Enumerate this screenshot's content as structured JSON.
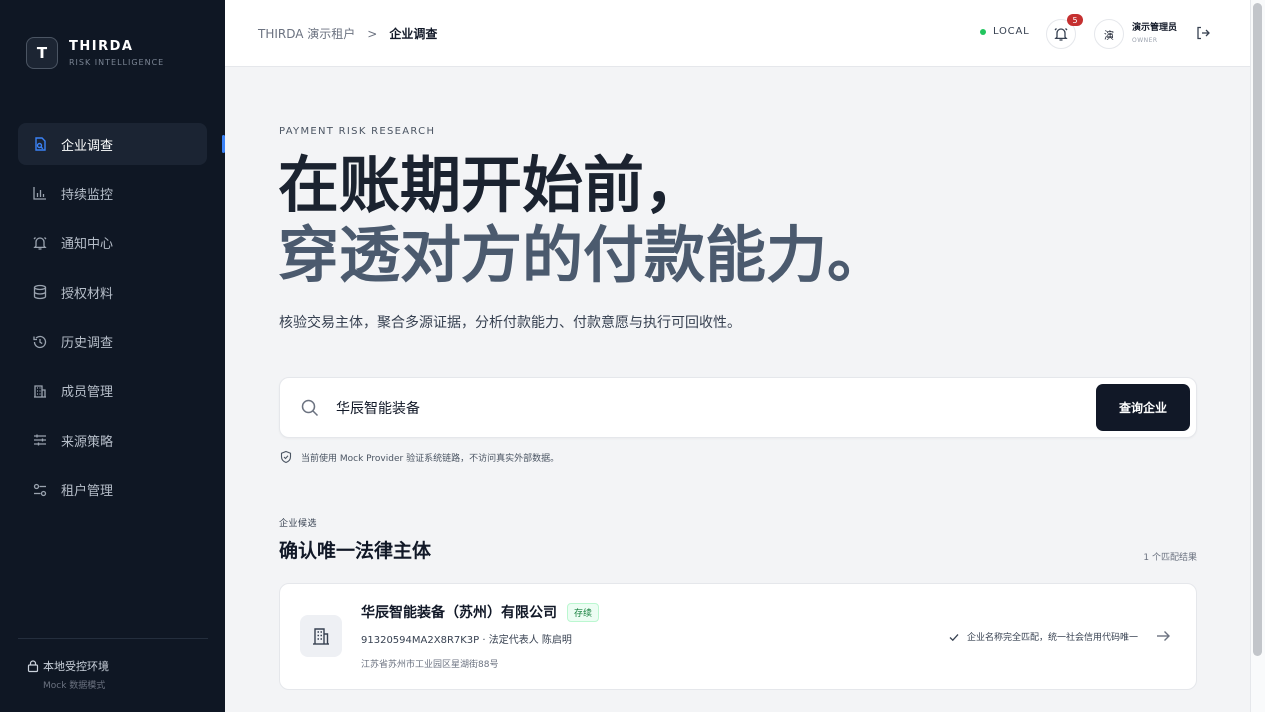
{
  "brand": {
    "logo_letter": "T",
    "name": "THIRDA",
    "subtitle": "RISK INTELLIGENCE"
  },
  "sidebar": {
    "items": [
      {
        "label": "企业调查",
        "icon": "search-document-icon",
        "active": true
      },
      {
        "label": "持续监控",
        "icon": "bar-chart-icon",
        "active": false
      },
      {
        "label": "通知中心",
        "icon": "bell-icon",
        "active": false
      },
      {
        "label": "授权材料",
        "icon": "database-icon",
        "active": false
      },
      {
        "label": "历史调查",
        "icon": "history-icon",
        "active": false
      },
      {
        "label": "成员管理",
        "icon": "building-icon",
        "active": false
      },
      {
        "label": "来源策略",
        "icon": "sliders-icon",
        "active": false
      },
      {
        "label": "租户管理",
        "icon": "settings-toggle-icon",
        "active": false
      }
    ],
    "environment": {
      "title": "本地受控环境",
      "subtitle": "Mock 数据模式"
    }
  },
  "header": {
    "breadcrumb": {
      "tenant": "THIRDA 演示租户",
      "separator": ">",
      "current": "企业调查"
    },
    "env_label": "LOCAL",
    "notifications_count": "5",
    "avatar_text": "演",
    "user_name": "演示管理员",
    "user_role": "OWNER"
  },
  "main": {
    "eyebrow": "PAYMENT RISK RESEARCH",
    "hero_line1": "在账期开始前，",
    "hero_line2": "穿透对方的付款能力。",
    "subtitle": "核验交易主体，聚合多源证据，分析付款能力、付款意愿与执行可回收性。",
    "search": {
      "value": "华辰智能装备",
      "placeholder": "",
      "button_label": "查询企业"
    },
    "notice": "当前使用 Mock Provider 验证系统链路，不访问真实外部数据。",
    "candidates": {
      "label": "企业候选",
      "title": "确认唯一法律主体",
      "count_text": "1 个匹配结果",
      "items": [
        {
          "name": "华辰智能装备（苏州）有限公司",
          "status": "存续",
          "meta": "91320594MA2X8R7K3P · 法定代表人 陈启明",
          "address": "江苏省苏州市工业园区星湖街88号",
          "match_note": "企业名称完全匹配，统一社会信用代码唯一"
        }
      ]
    }
  },
  "colors": {
    "sidebar_bg": "#0f1724",
    "accent": "#3b82f6",
    "primary_button": "#111827",
    "status_green": "#15803d",
    "badge_red": "#c53030"
  }
}
